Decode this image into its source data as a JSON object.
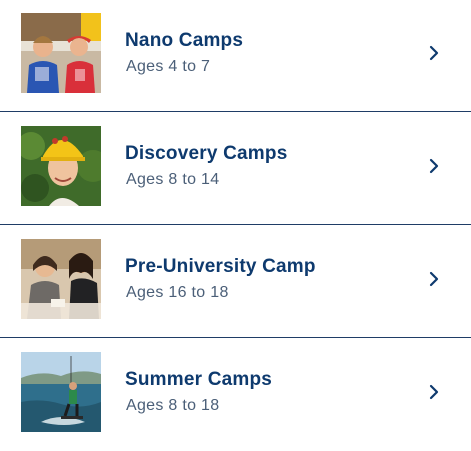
{
  "camps": [
    {
      "title": "Nano Camps",
      "ages": "Ages 4 to 7",
      "image": "kids-in-pinnies-photo",
      "icon": "chevron-right-icon"
    },
    {
      "title": "Discovery Camps",
      "ages": "Ages 8 to 14",
      "image": "child-in-yellow-helmet-photo",
      "icon": "chevron-right-icon"
    },
    {
      "title": "Pre-University Camp",
      "ages": "Ages 16 to 18",
      "image": "students-at-table-photo",
      "icon": "chevron-right-icon"
    },
    {
      "title": "Summer Camps",
      "ages": "Ages 8 to 18",
      "image": "wakeboarder-on-lake-photo",
      "icon": "chevron-right-icon"
    }
  ],
  "colors": {
    "title": "#0e3a6e",
    "subtitle": "#4b5f78",
    "divider": "#1f3d66",
    "chevron": "#0e3a6e"
  }
}
